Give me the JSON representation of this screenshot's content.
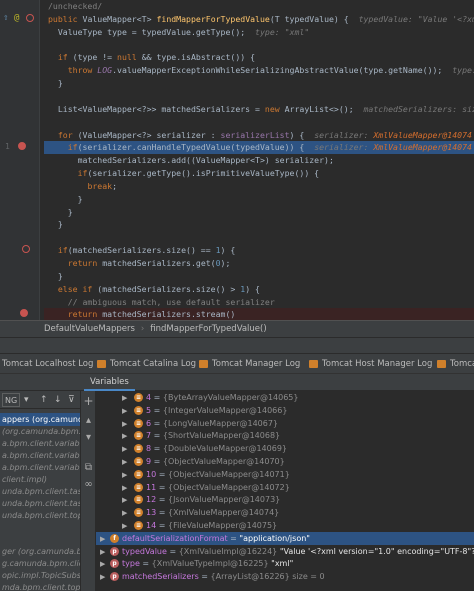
{
  "editor": {
    "lines": [
      {
        "segments": [
          {
            "t": "/unchecked/",
            "c": "cm"
          }
        ]
      },
      {
        "segments": [
          {
            "t": "public ",
            "c": "kw"
          },
          {
            "t": "ValueMapper<",
            "c": "ty"
          },
          {
            "t": "T",
            "c": "ty"
          },
          {
            "t": "> ",
            "c": "ty"
          },
          {
            "t": "findMapperForTypedValue",
            "c": "fn"
          },
          {
            "t": "(T typedValue) {  ",
            "c": "ty"
          },
          {
            "t": "typedValue: \"Value '<?xml versi",
            "c": "hint"
          }
        ]
      },
      {
        "segments": [
          {
            "t": "  ValueType type = typedValue.getType();  ",
            "c": "ty"
          },
          {
            "t": "type: \"xml\"",
            "c": "hint"
          }
        ]
      },
      {
        "segments": []
      },
      {
        "segments": [
          {
            "t": "  ",
            "c": "ty"
          },
          {
            "t": "if ",
            "c": "kw"
          },
          {
            "t": "(type != ",
            "c": "ty"
          },
          {
            "t": "null ",
            "c": "kw"
          },
          {
            "t": "&& type.isAbstract()) {",
            "c": "ty"
          }
        ]
      },
      {
        "segments": [
          {
            "t": "    ",
            "c": "ty"
          },
          {
            "t": "throw ",
            "c": "kw"
          },
          {
            "t": "LOG",
            "c": "static"
          },
          {
            "t": ".valueMapperExceptionWhileSerializingAbstractValue(type.getName());  ",
            "c": "ty"
          },
          {
            "t": "type: \"xml",
            "c": "hint"
          }
        ]
      },
      {
        "segments": [
          {
            "t": "  }",
            "c": "ty"
          }
        ]
      },
      {
        "segments": []
      },
      {
        "segments": [
          {
            "t": "  List<ValueMapper<?>> matchedSerializers = ",
            "c": "ty"
          },
          {
            "t": "new ",
            "c": "kw"
          },
          {
            "t": "ArrayList<>();  ",
            "c": "ty"
          },
          {
            "t": "matchedSerializers: size = 0",
            "c": "hint"
          }
        ]
      },
      {
        "segments": []
      },
      {
        "segments": [
          {
            "t": "  ",
            "c": "ty"
          },
          {
            "t": "for ",
            "c": "kw"
          },
          {
            "t": "(ValueMapper<?> serializer : ",
            "c": "ty"
          },
          {
            "t": "serializerList",
            "c": "fld"
          },
          {
            "t": ") {  ",
            "c": "ty"
          },
          {
            "t": "serializer: ",
            "c": "hint"
          },
          {
            "t": "XmlValueMapper@14074",
            "c": "hintval"
          },
          {
            "t": "  seria",
            "c": "hint"
          }
        ]
      },
      {
        "segments": [
          {
            "t": "    ",
            "c": "ty"
          },
          {
            "t": "if",
            "c": "kw"
          },
          {
            "t": "(serializer.canHandleTypedValue(typedValue)) {  ",
            "c": "ty"
          },
          {
            "t": "serializer: ",
            "c": "hint"
          },
          {
            "t": "XmlValueMapper@14074",
            "c": "hintval"
          },
          {
            "t": "  typedVa",
            "c": "hint"
          }
        ]
      },
      {
        "segments": [
          {
            "t": "      matchedSerializers.add((ValueMapper<T>) serializer);",
            "c": "ty"
          }
        ]
      },
      {
        "segments": [
          {
            "t": "      ",
            "c": "ty"
          },
          {
            "t": "if",
            "c": "kw"
          },
          {
            "t": "(serializer.getType().isPrimitiveValueType()) {",
            "c": "ty"
          }
        ]
      },
      {
        "segments": [
          {
            "t": "        ",
            "c": "ty"
          },
          {
            "t": "break",
            "c": "kw"
          },
          {
            "t": ";",
            "c": "ty"
          }
        ]
      },
      {
        "segments": [
          {
            "t": "      }",
            "c": "ty"
          }
        ]
      },
      {
        "segments": [
          {
            "t": "    }",
            "c": "ty"
          }
        ]
      },
      {
        "segments": [
          {
            "t": "  }",
            "c": "ty"
          }
        ]
      },
      {
        "segments": []
      },
      {
        "segments": [
          {
            "t": "  ",
            "c": "ty"
          },
          {
            "t": "if",
            "c": "kw"
          },
          {
            "t": "(matchedSerializers.size() == ",
            "c": "ty"
          },
          {
            "t": "1",
            "c": "num"
          },
          {
            "t": ") {",
            "c": "ty"
          }
        ]
      },
      {
        "segments": [
          {
            "t": "    ",
            "c": "ty"
          },
          {
            "t": "return ",
            "c": "kw"
          },
          {
            "t": "matchedSerializers.get(",
            "c": "ty"
          },
          {
            "t": "0",
            "c": "num"
          },
          {
            "t": ");",
            "c": "ty"
          }
        ]
      },
      {
        "segments": [
          {
            "t": "  }",
            "c": "ty"
          }
        ]
      },
      {
        "segments": [
          {
            "t": "  ",
            "c": "ty"
          },
          {
            "t": "else if ",
            "c": "kw"
          },
          {
            "t": "(matchedSerializers.size() > ",
            "c": "ty"
          },
          {
            "t": "1",
            "c": "num"
          },
          {
            "t": ") {",
            "c": "ty"
          }
        ]
      },
      {
        "segments": [
          {
            "t": "    // ambiguous match, use default serializer",
            "c": "cm"
          }
        ]
      },
      {
        "segments": [
          {
            "t": "    ",
            "c": "ty"
          },
          {
            "t": "return ",
            "c": "kw"
          },
          {
            "t": "matchedSerializers.stream()",
            "c": "ty"
          }
        ]
      }
    ]
  },
  "breadcrumb": {
    "class_name": "DefaultValueMappers",
    "method_name": "findMapperForTypedValue()"
  },
  "tabs": [
    {
      "label": "Tomcat Localhost Log"
    },
    {
      "label": "Tomcat Catalina Log"
    },
    {
      "label": "Tomcat Manager Log"
    },
    {
      "label": "Tomcat Host Manager Log"
    },
    {
      "label": "Tomcat"
    }
  ],
  "debugger": {
    "variables_tab": "Variables",
    "frames_dropdown": "NG",
    "frames": [
      "appers (org.camunda.bpm",
      "(org.camunda.bpm.engine",
      "a.bpm.client.variable.imp",
      "a.bpm.client.variable.imp",
      "a.bpm.client.variable.imp",
      "client.impl)",
      "unda.bpm.client.task.imp",
      "unda.bpm.client.task.imp",
      "unda.bpm.client.topic.imp",
      "",
      "",
      "ger (org.camunda.bpm",
      "g.camunda.bpm.client.top",
      "opic.impl.TopicSubscript",
      "mda.bpm.client.topic.imp"
    ],
    "selected_frame": 0,
    "variables": [
      {
        "index": "4",
        "value": "{ByteArrayValueMapper@14065}"
      },
      {
        "index": "5",
        "value": "{IntegerValueMapper@14066}"
      },
      {
        "index": "6",
        "value": "{LongValueMapper@14067}"
      },
      {
        "index": "7",
        "value": "{ShortValueMapper@14068}"
      },
      {
        "index": "8",
        "value": "{DoubleValueMapper@14069}"
      },
      {
        "index": "9",
        "value": "{ObjectValueMapper@14070}"
      },
      {
        "index": "10",
        "value": "{ObjectValueMapper@14071}"
      },
      {
        "index": "11",
        "value": "{ObjectValueMapper@14072}"
      },
      {
        "index": "12",
        "value": "{JsonValueMapper@14073}"
      },
      {
        "index": "13",
        "value": "{XmlValueMapper@14074}"
      },
      {
        "index": "14",
        "value": "{FileValueMapper@14075}"
      }
    ],
    "fields": [
      {
        "name": "defaultSerializationFormat",
        "type_text": "",
        "value": "\"application/json\"",
        "icon": "f"
      },
      {
        "name": "typedValue",
        "type_text": "{XmlValueImpl@16224}",
        "value": "\"Value '<?xml version=\"1.0\" encoding=\"UTF-8\"?> <rdf:RDF xmlns:",
        "icon": "p"
      },
      {
        "name": "type",
        "type_text": "{XmlValueTypeImpl@16225}",
        "value": "\"xml\"",
        "icon": "p"
      },
      {
        "name": "matchedSerializers",
        "type_text": "{ArrayList@16226}",
        "value": "size = 0",
        "icon": "p"
      }
    ]
  }
}
